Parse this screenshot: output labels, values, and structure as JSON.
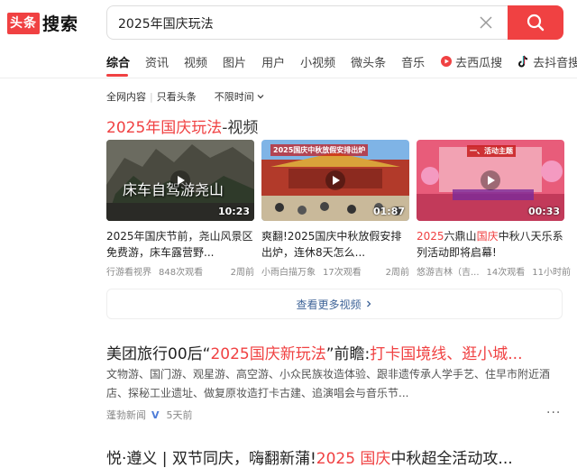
{
  "header": {
    "logo_box": "头条",
    "logo_text": "搜索",
    "search_value": "2025年国庆玩法",
    "colors": {
      "accent": "#f04142"
    }
  },
  "tabs": [
    {
      "label": "综合",
      "active": true
    },
    {
      "label": "资讯"
    },
    {
      "label": "视频"
    },
    {
      "label": "图片"
    },
    {
      "label": "用户"
    },
    {
      "label": "小视频"
    },
    {
      "label": "微头条"
    },
    {
      "label": "音乐"
    },
    {
      "label": "去西瓜搜",
      "icon": "xigua-icon"
    },
    {
      "label": "去抖音搜",
      "icon": "douyin-icon"
    }
  ],
  "filters": {
    "all": "全网内容",
    "sep": "|",
    "only": "只看头条",
    "time": "不限时间"
  },
  "video_section": {
    "title_kw": "2025年国庆玩法",
    "title_rest": "-视频",
    "cards": [
      {
        "duration": "10:23",
        "overlay": "床车自驾游尧山",
        "title": "2025年国庆节前，尧山风景区免费游，床车露营野...",
        "source": "行游看视界",
        "views": "848次观看",
        "time": "2周前"
      },
      {
        "duration": "01:87",
        "caption": "2025国庆中秋放假安排出炉",
        "title_pre": "爽翻!2025国庆中秋放假安排出炉，连休8天怎么...",
        "source": "小雨白描万象",
        "views": "17次观看",
        "time": "2周前"
      },
      {
        "duration": "00:33",
        "caption": "一、活动主题",
        "title_a": "2025",
        "title_b": "六鼎山",
        "title_c": "国庆",
        "title_d": "中秋八天乐系列活动即将启幕!",
        "source": "悠游吉林（吉...",
        "views": "14次观看",
        "time": "11小时前"
      }
    ],
    "more_label": "查看更多视频"
  },
  "result1": {
    "title_a": "美团旅行00后“",
    "title_b": "2025国庆新玩法",
    "title_c": "”前瞻:",
    "title_d": "打卡国境线、逛小城...",
    "snippet": "文物游、国门游、观星游、高空游、小众民族妆造体验、跟非遗传承人学手艺、住早市附近酒店、探秘工业遗址、做复原妆造打卡古建、追演唱会与音乐节...",
    "source": "蓬勃新闻",
    "verified": "V",
    "time": "5天前",
    "more": "···"
  },
  "result2": {
    "title_a": "悦·遵义 | 双节同庆，嗨翻新蒲!",
    "title_b": "2025 国庆",
    "title_c": "中秋超全活动攻..."
  }
}
